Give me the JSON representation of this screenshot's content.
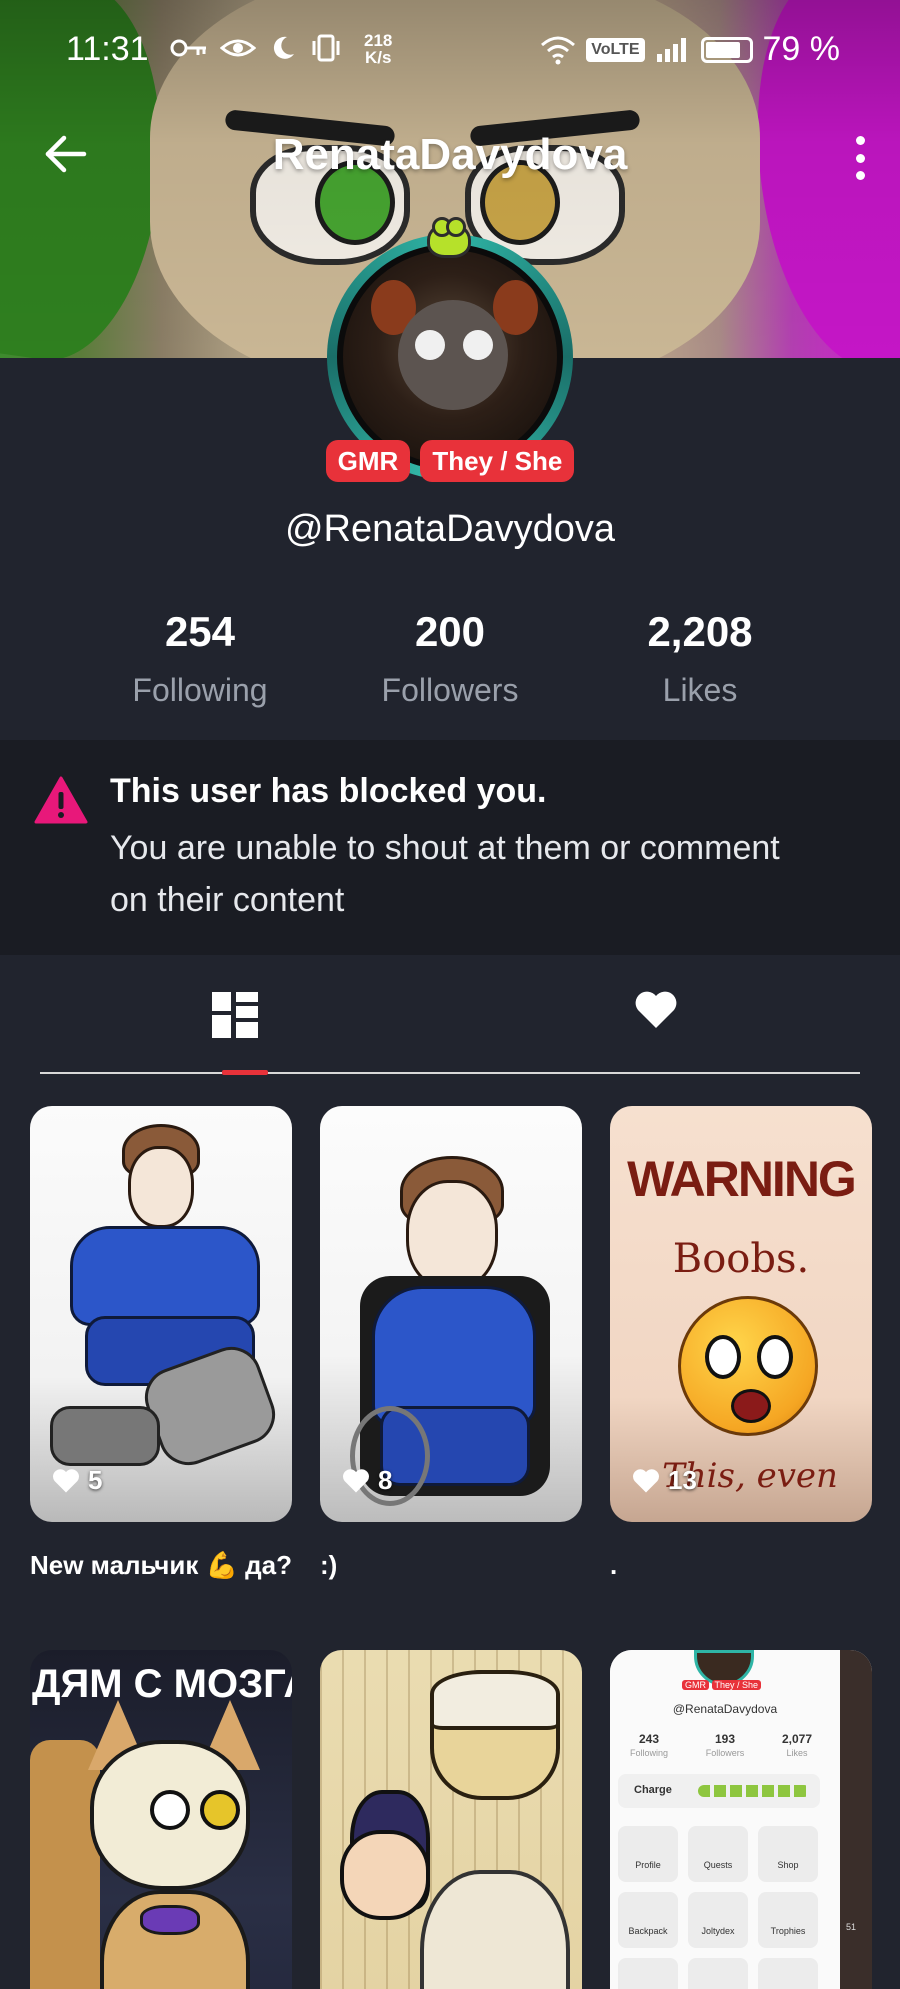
{
  "status_bar": {
    "time": "11:31",
    "speed_value": "218",
    "speed_unit": "K/s",
    "network_badge": "VoLTE",
    "battery": "79 %"
  },
  "header": {
    "title": "RenataDavydova"
  },
  "profile": {
    "badges": [
      "GMR",
      "They / She"
    ],
    "handle": "@RenataDavydova",
    "stats": [
      {
        "value": "254",
        "label": "Following"
      },
      {
        "value": "200",
        "label": "Followers"
      },
      {
        "value": "2,208",
        "label": "Likes"
      }
    ]
  },
  "blocked_notice": {
    "title": "This user has blocked you.",
    "message": "You are unable to shout at them or comment on their content"
  },
  "tabs": {
    "active": "posts",
    "icons": [
      "grid-icon",
      "heart-icon"
    ]
  },
  "posts": [
    {
      "likes": "5",
      "caption": "New мальчик 💪 да?"
    },
    {
      "likes": "8",
      "caption": ":)"
    },
    {
      "likes": "13",
      "caption": ".",
      "image_text": [
        "WARNING",
        "Boobs.",
        "This, even"
      ]
    },
    {
      "image_text": [
        "ДЯМ С МОЗГА"
      ]
    },
    {},
    {
      "image_text": [
        "GMR",
        "They / She",
        "@RenataDavydova",
        "243",
        "Following",
        "193",
        "Followers",
        "2,077",
        "Likes",
        "Charge",
        "Profile",
        "Quests",
        "Shop",
        "Backpack",
        "Joltydex",
        "Trophies",
        "51"
      ]
    }
  ],
  "colors": {
    "background": "#21242e",
    "notice_background": "#1a1c23",
    "accent_red": "#e8323a",
    "warning_pink": "#e8187a",
    "muted_text": "#9aa0ab"
  }
}
